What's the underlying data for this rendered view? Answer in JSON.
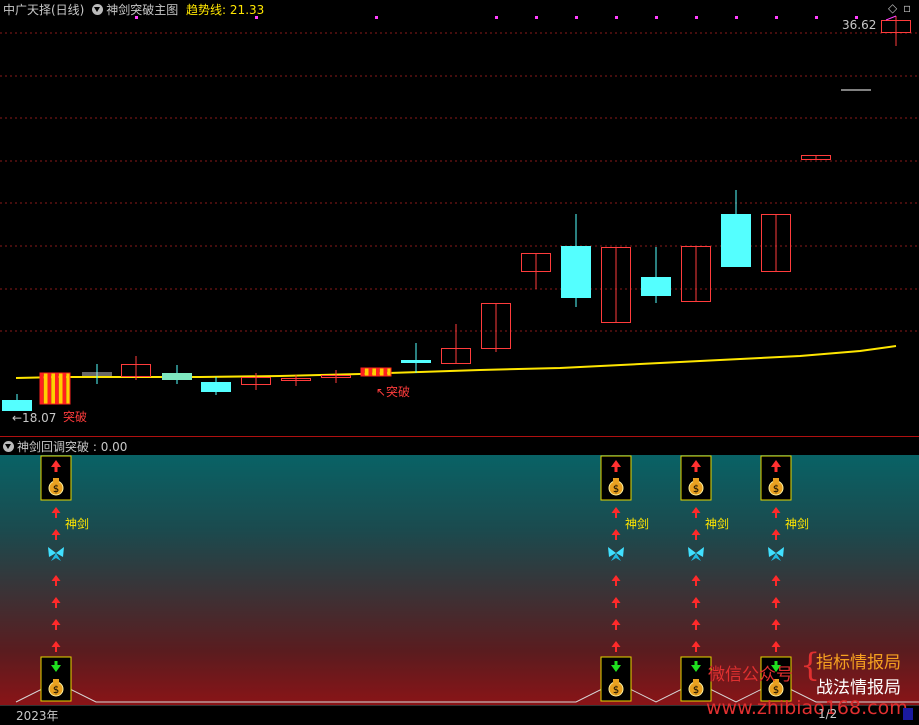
{
  "header": {
    "stock_name": "中广天择(日线)",
    "indicator_name": "神剑突破主图",
    "trend_label": "趋势线:",
    "trend_value": "21.33"
  },
  "price_labels": {
    "high": "36.62",
    "low": "←18.07",
    "breakout_1": "突破",
    "breakout_2": "↖突破"
  },
  "sub_panel": {
    "title": "神剑回调突破",
    "value": ": 0.00",
    "label": "神剑"
  },
  "watermark": {
    "prefix": "微信公众号",
    "line1": "指标情报局",
    "line2": "战法情报局",
    "url": "www.zhibiao168.com"
  },
  "date_axis": {
    "year": "2023年",
    "right_label": "1/2"
  },
  "colors": {
    "up": "#ff3c3c",
    "down": "#54ffff",
    "trend": "#ffe600",
    "text": "#c0c0c0",
    "accent_gold": "#ffe600",
    "grid": "#8a1a1a"
  },
  "icons": {
    "collapse": "chevron-circle-icon",
    "signal_top": "money-bag-icon",
    "signal_bottom": "money-bag-icon",
    "mid": "butterfly-icon",
    "arrow": "up-arrow-icon"
  }
}
